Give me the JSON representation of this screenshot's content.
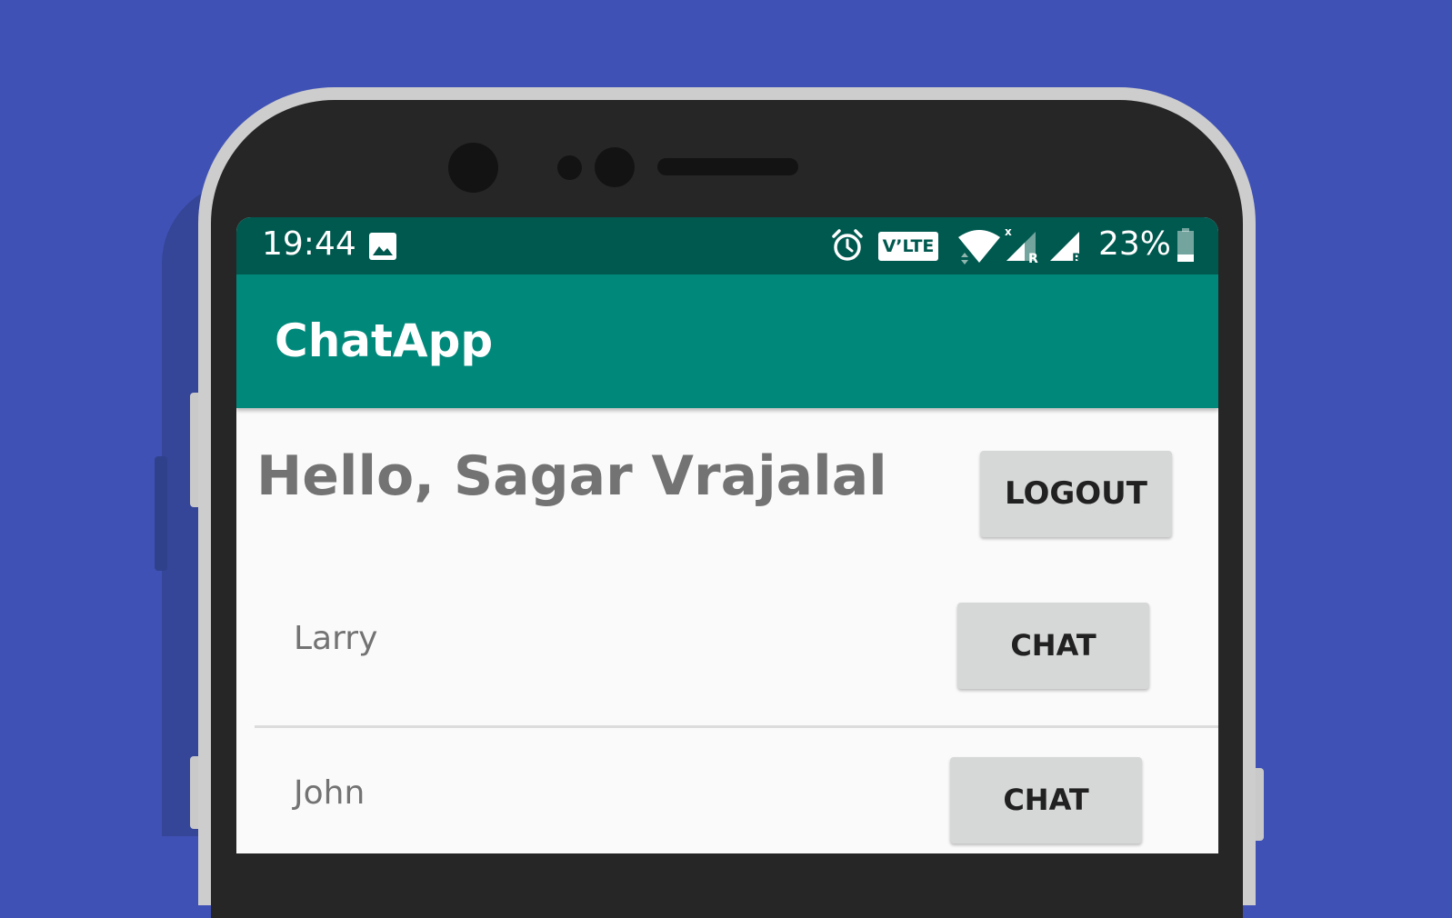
{
  "status_bar": {
    "time": "19:44",
    "battery_percent": "23%",
    "volte_label": "V’LTE",
    "icons": [
      "image-icon",
      "alarm-icon",
      "volte-icon",
      "wifi-icon",
      "signal-icon",
      "signal-icon",
      "battery-icon"
    ],
    "battery_level": 0.23
  },
  "app_bar": {
    "title": "ChatApp"
  },
  "main": {
    "greeting": "Hello, Sagar Vrajalal",
    "logout_label": "LOGOUT",
    "contacts": [
      {
        "name": "Larry",
        "action_label": "CHAT"
      },
      {
        "name": "John",
        "action_label": "CHAT"
      }
    ]
  },
  "colors": {
    "background": "#3f51b5",
    "status_bar": "#00594f",
    "app_bar": "#00897b",
    "button": "#d6d7d7"
  }
}
